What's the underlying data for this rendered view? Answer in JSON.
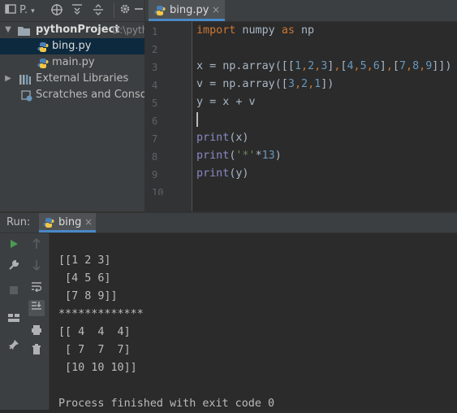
{
  "project_toolbar": {
    "view_label": "P.",
    "icons": [
      "project-icon",
      "crosshair-icon",
      "expand-all-icon",
      "collapse-all-icon",
      "gear-icon",
      "minimize-icon"
    ]
  },
  "project_tree": {
    "root": {
      "name": "pythonProject",
      "path": "D:\\pyth"
    },
    "files": [
      "bing.py",
      "main.py"
    ],
    "selected_file": "bing.py",
    "external_libraries": "External Libraries",
    "scratches": "Scratches and Console"
  },
  "editor": {
    "tab_title": "bing.py",
    "close_glyph": "×",
    "line_numbers": [
      "1",
      "2",
      "3",
      "4",
      "5",
      "6",
      "7",
      "8",
      "9",
      "10"
    ],
    "lines": [
      "import numpy as np",
      "",
      "x = np.array([[1,2,3],[4,5,6],[7,8,9]])",
      "v = np.array([3,2,1])",
      "y = x + v",
      "",
      "print(x)",
      "print('*'*13)",
      "print(y)",
      ""
    ],
    "current_line": 6
  },
  "run_panel": {
    "label": "Run:",
    "tab_title": "bing",
    "close_glyph": "×",
    "output": [
      "",
      "[[1 2 3]",
      " [4 5 6]",
      " [7 8 9]]",
      "*************",
      "[[ 4  4  4]",
      " [ 7  7  7]",
      " [10 10 10]]",
      "",
      "Process finished with exit code 0"
    ]
  },
  "colors": {
    "keyword": "#cc7832",
    "number": "#6897bb",
    "string": "#6a8759",
    "builtin": "#8888c6",
    "text": "#a9b7c6",
    "accent": "#4a88c7",
    "selection": "#0d293e"
  }
}
